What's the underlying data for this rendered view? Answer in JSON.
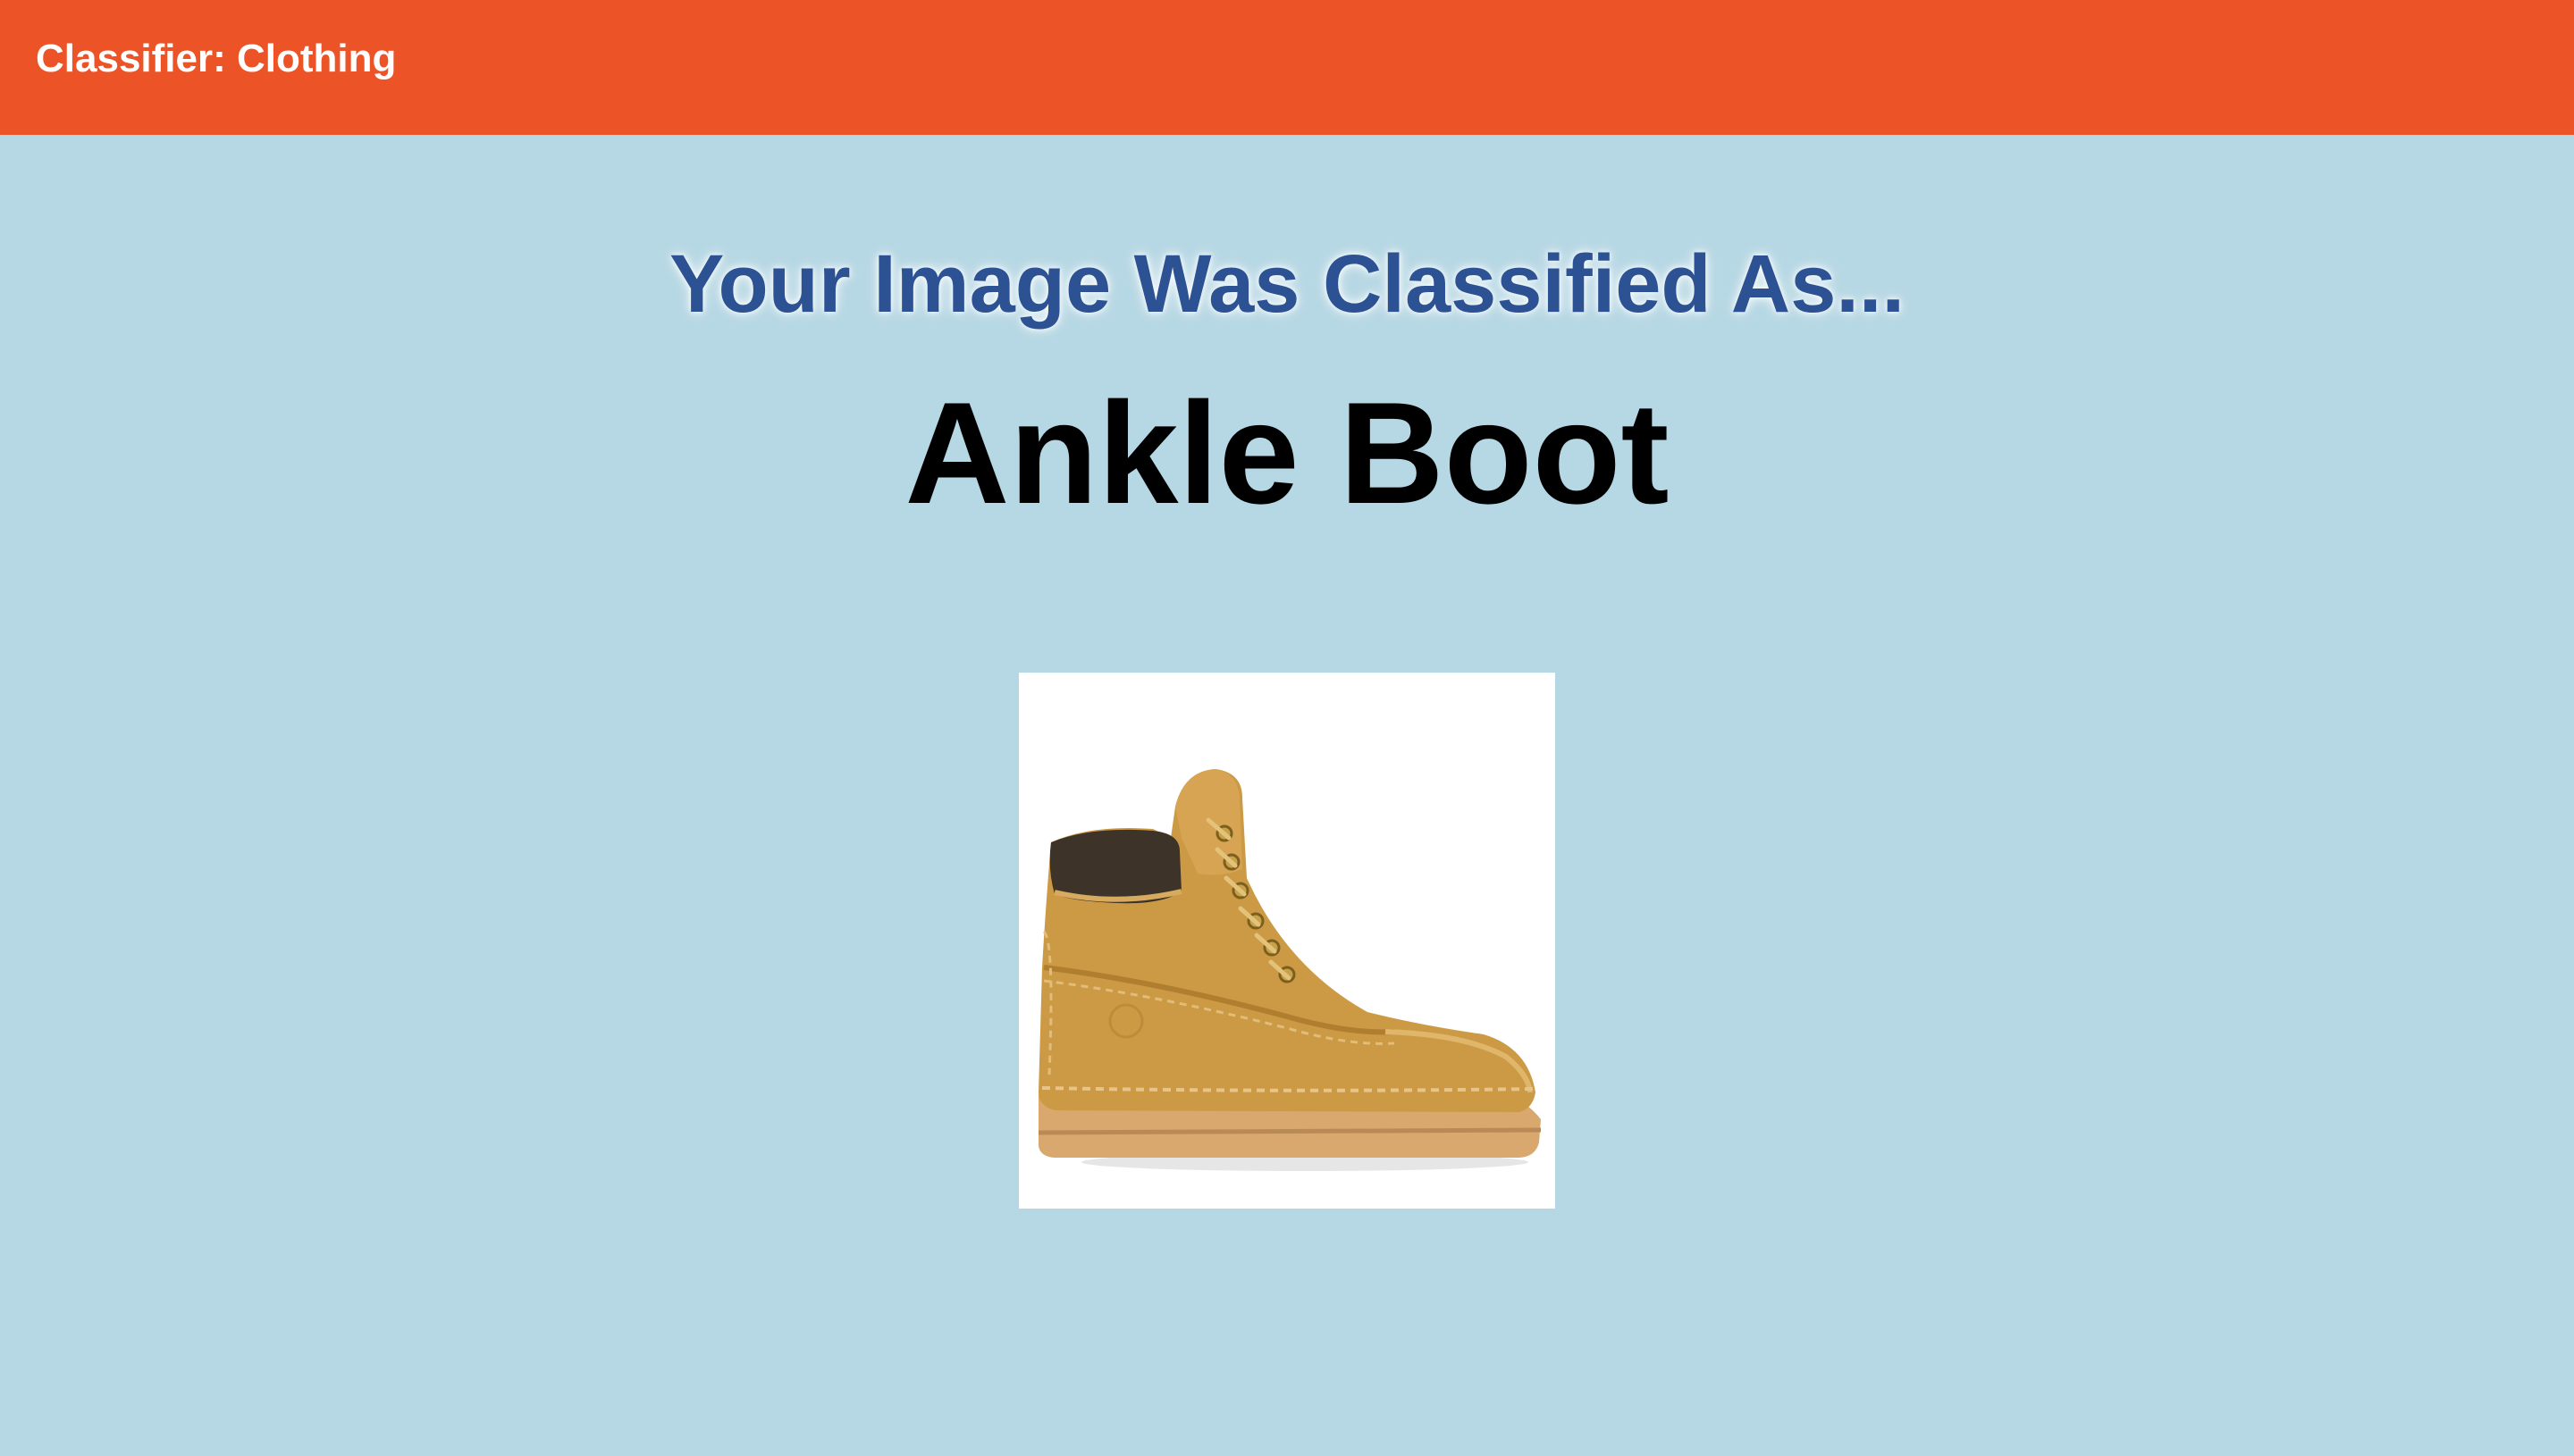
{
  "header": {
    "title": "Classifier: Clothing"
  },
  "result": {
    "heading": "Your Image Was Classified As...",
    "label": "Ankle Boot",
    "image_icon": "ankle-boot-photo"
  },
  "colors": {
    "header_bg": "#ec5428",
    "page_bg": "#b6d7e4",
    "heading_text": "#2c5294",
    "label_text": "#000000"
  }
}
